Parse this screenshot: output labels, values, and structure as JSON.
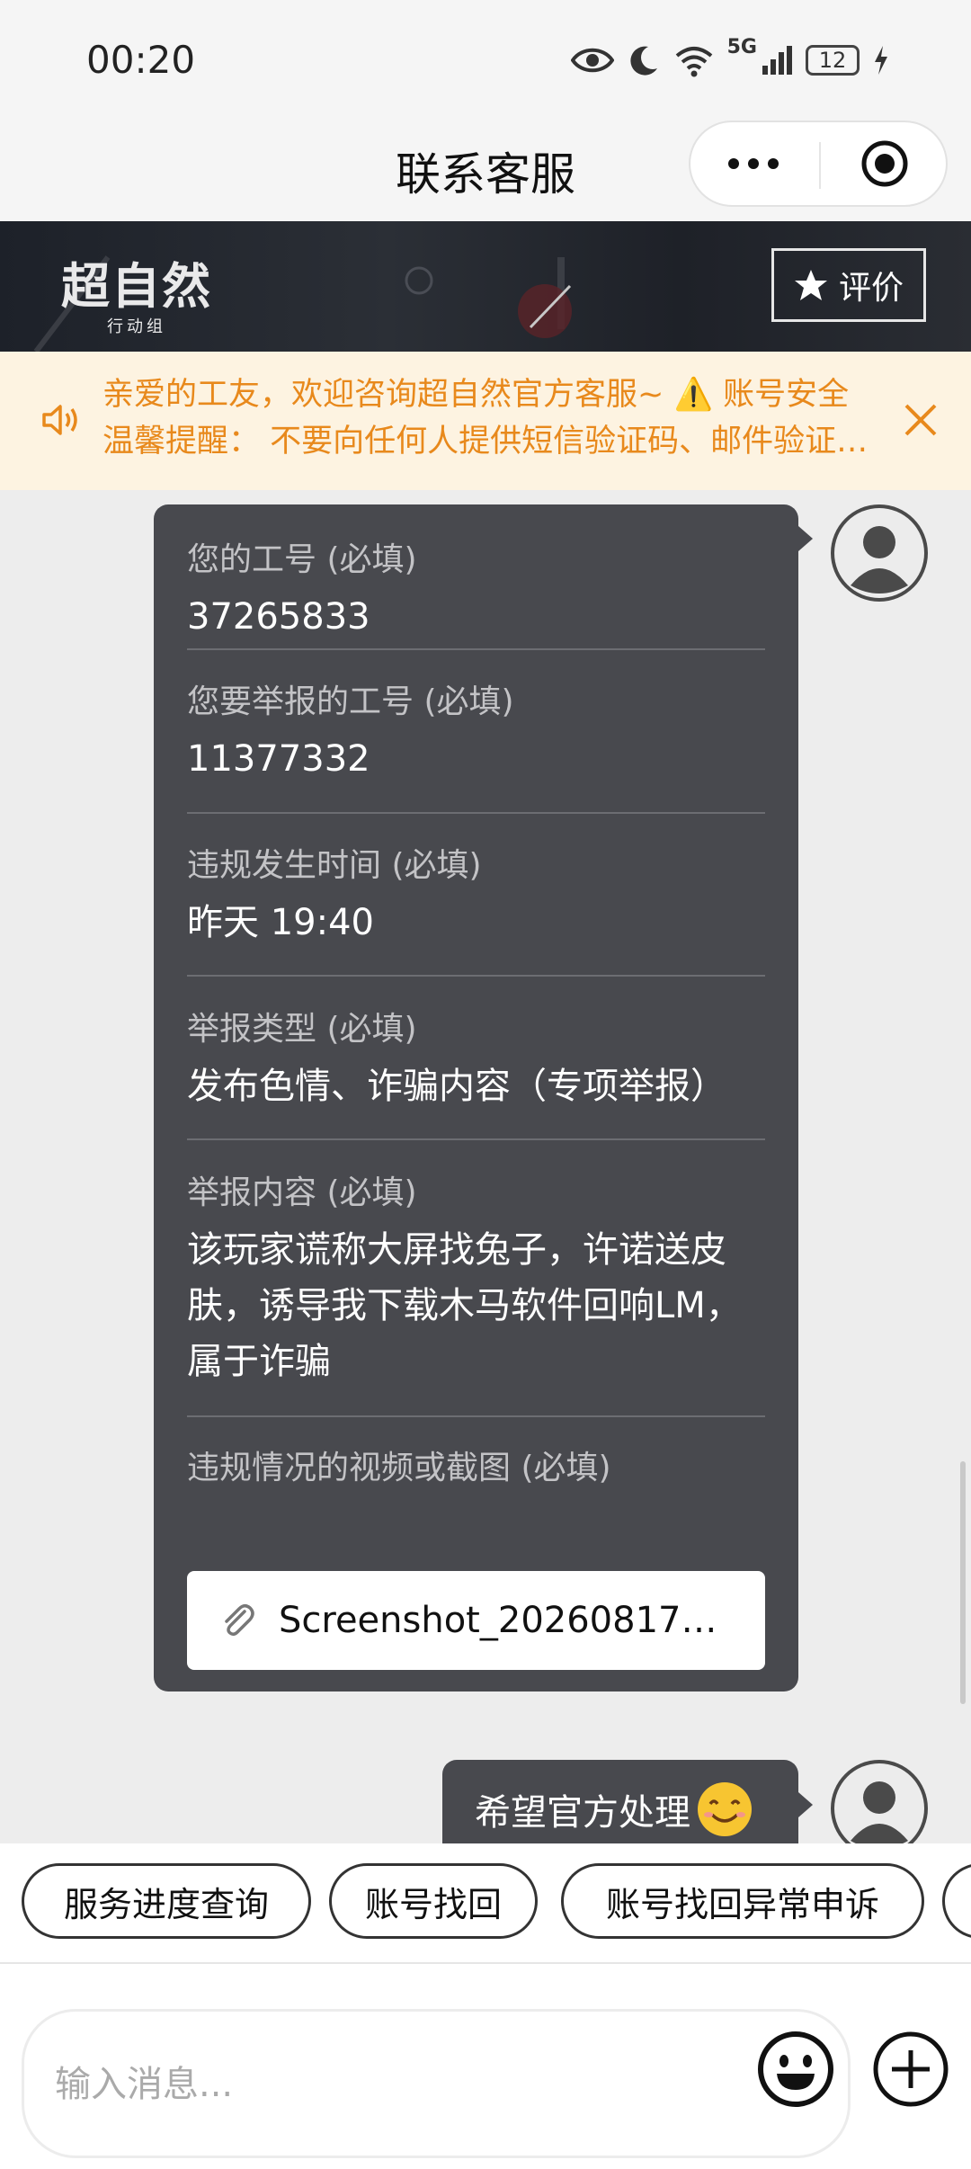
{
  "status_bar": {
    "time": "00:20",
    "battery": "12",
    "network": "5G"
  },
  "title_bar": {
    "title": "联系客服"
  },
  "banner": {
    "logo_text": "超自然",
    "logo_sub": "行动组",
    "rate_label": "评价"
  },
  "notice": {
    "line1": "亲爱的工友，欢迎咨询超自然官方客服~ ⚠️ 账号安全",
    "line2": "温馨提醒： 不要向任何人提供短信验证码、邮件验证…"
  },
  "form": {
    "fields": [
      {
        "label": "您的工号 (必填)",
        "value": "37265833"
      },
      {
        "label": "您要举报的工号 (必填)",
        "value": "11377332"
      },
      {
        "label": "违规发生时间 (必填)",
        "value": "昨天 19:40"
      },
      {
        "label": "举报类型 (必填)",
        "value": "发布色情、诈骗内容（专项举报）"
      },
      {
        "label": "举报内容 (必填)",
        "value": "该玩家谎称大屏找兔子，许诺送皮肤，诱导我下载木马软件回响LM，属于诈骗"
      }
    ],
    "attachment_label": "违规情况的视频或截图 (必填)",
    "attachment_name": "Screenshot_20260817_…"
  },
  "message": {
    "text": "希望官方处理"
  },
  "quick_replies": [
    "服务进度查询",
    "账号找回",
    "账号找回异常申诉"
  ],
  "input": {
    "placeholder": "输入消息..."
  },
  "colors": {
    "bubble": "#48494e",
    "notice_text": "#e8891c",
    "notice_bg": "#fdf3e1"
  }
}
